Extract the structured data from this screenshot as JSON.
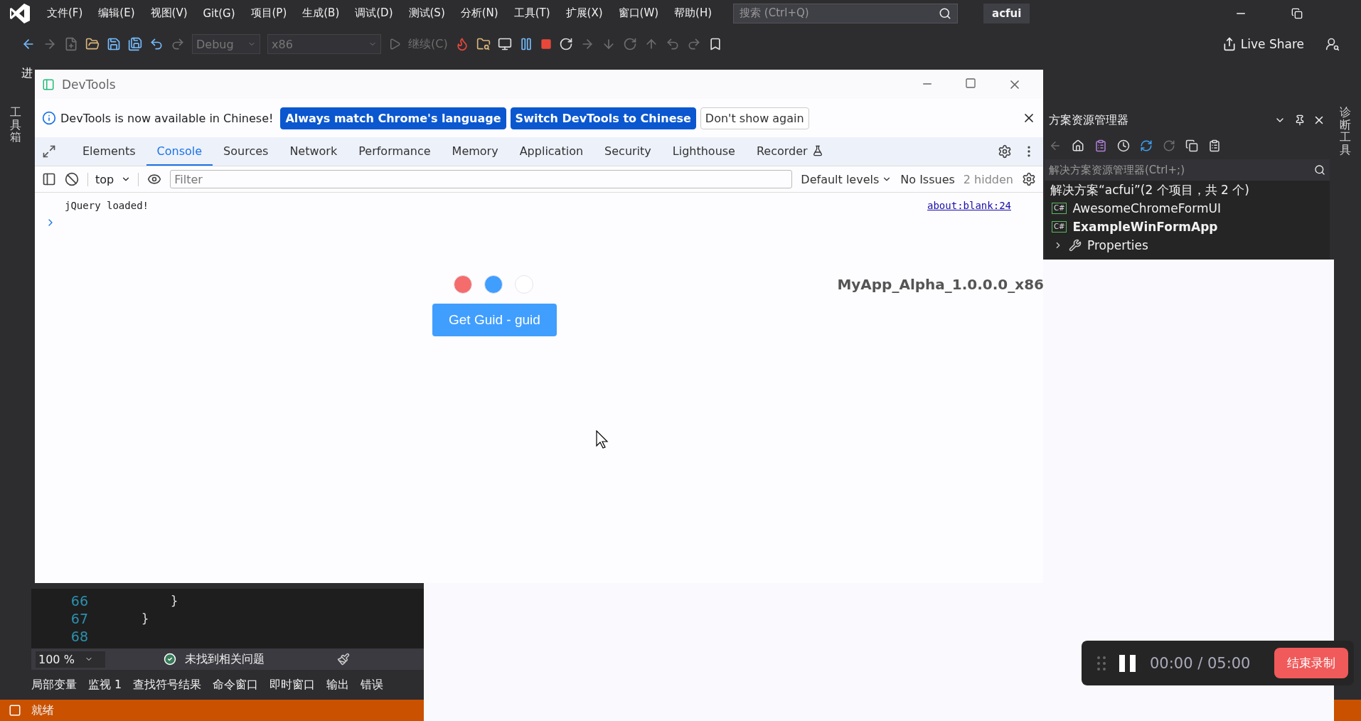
{
  "ide": {
    "menu": [
      "文件(F)",
      "编辑(E)",
      "视图(V)",
      "Git(G)",
      "项目(P)",
      "生成(B)",
      "调试(D)",
      "测试(S)",
      "分析(N)",
      "工具(T)",
      "扩展(X)",
      "窗口(W)",
      "帮助(H)"
    ],
    "search": {
      "placeholder": "搜索 (Ctrl+Q)"
    },
    "solution_name": "acfui",
    "toolbar": {
      "configuration": "Debug",
      "platform": "x86",
      "continue": "继续(C)",
      "live_share": "Live Share"
    },
    "document_tab": "进",
    "left_strip": "工具箱",
    "right_strip": "诊断工具",
    "solution_explorer": {
      "title": "方案资源管理器",
      "search": {
        "placeholder": "解决方案资源管理器(Ctrl+;)"
      },
      "tree": [
        {
          "label": "解决方案“acfui”(2 个项目，共 2 个)",
          "children": [
            {
              "label": "AwesomeChromeFormUI",
              "kind": "csharp",
              "badge": "C#",
              "startup": false
            },
            {
              "label": "ExampleWinFormApp",
              "kind": "csharp",
              "badge": "C#",
              "startup": true,
              "children": [
                {
                  "label": "Properties",
                  "kind": "properties",
                  "expanded": false
                }
              ]
            }
          ]
        }
      ]
    },
    "editor": {
      "lines": [
        {
          "number": "66",
          "code": "    }"
        },
        {
          "number": "67",
          "code": "}"
        },
        {
          "number": "68"
        }
      ],
      "zoom": "100 %",
      "issues": "未找到相关问题"
    },
    "tool_tabs": [
      "局部变量",
      "监视 1",
      "查找符号结果",
      "命令窗口",
      "即时窗口",
      "输出",
      "错误"
    ],
    "status": "就绪"
  },
  "devtools": {
    "title": "DevTools",
    "infobar": {
      "message": "DevTools is now available in Chinese!",
      "buttons": [
        {
          "label": "Always match Chrome's language",
          "kind": "primary"
        },
        {
          "label": "Switch DevTools to Chinese",
          "kind": "primary"
        },
        {
          "label": "Don't show again",
          "kind": "secondary"
        }
      ]
    },
    "tabs": [
      {
        "label": "Elements",
        "selected": false,
        "experimental": false
      },
      {
        "label": "Console",
        "selected": true,
        "experimental": false
      },
      {
        "label": "Sources",
        "selected": false,
        "experimental": false
      },
      {
        "label": "Network",
        "selected": false,
        "experimental": false
      },
      {
        "label": "Performance",
        "selected": false,
        "experimental": false
      },
      {
        "label": "Memory",
        "selected": false,
        "experimental": false
      },
      {
        "label": "Application",
        "selected": false,
        "experimental": false
      },
      {
        "label": "Security",
        "selected": false,
        "experimental": false
      },
      {
        "label": "Lighthouse",
        "selected": false,
        "experimental": false
      },
      {
        "label": "Recorder",
        "selected": false,
        "experimental": true
      }
    ],
    "console": {
      "context": "top",
      "filter": {
        "placeholder": "Filter"
      },
      "levels": "Default levels",
      "issues": "No Issues",
      "hidden": "2 hidden",
      "messages": [
        {
          "text": "jQuery loaded!",
          "source": "about:blank:24"
        }
      ]
    }
  },
  "app": {
    "dots": [
      {
        "color": "#f56c6c"
      },
      {
        "color": "#409eff"
      },
      {
        "color": "#ffffff"
      }
    ],
    "title": "MyApp_Alpha_1.0.0.0_x86",
    "button": "Get Guid - guid"
  },
  "recorder": {
    "elapsed": "00:00 / 05:00",
    "stop": "结束录制"
  }
}
